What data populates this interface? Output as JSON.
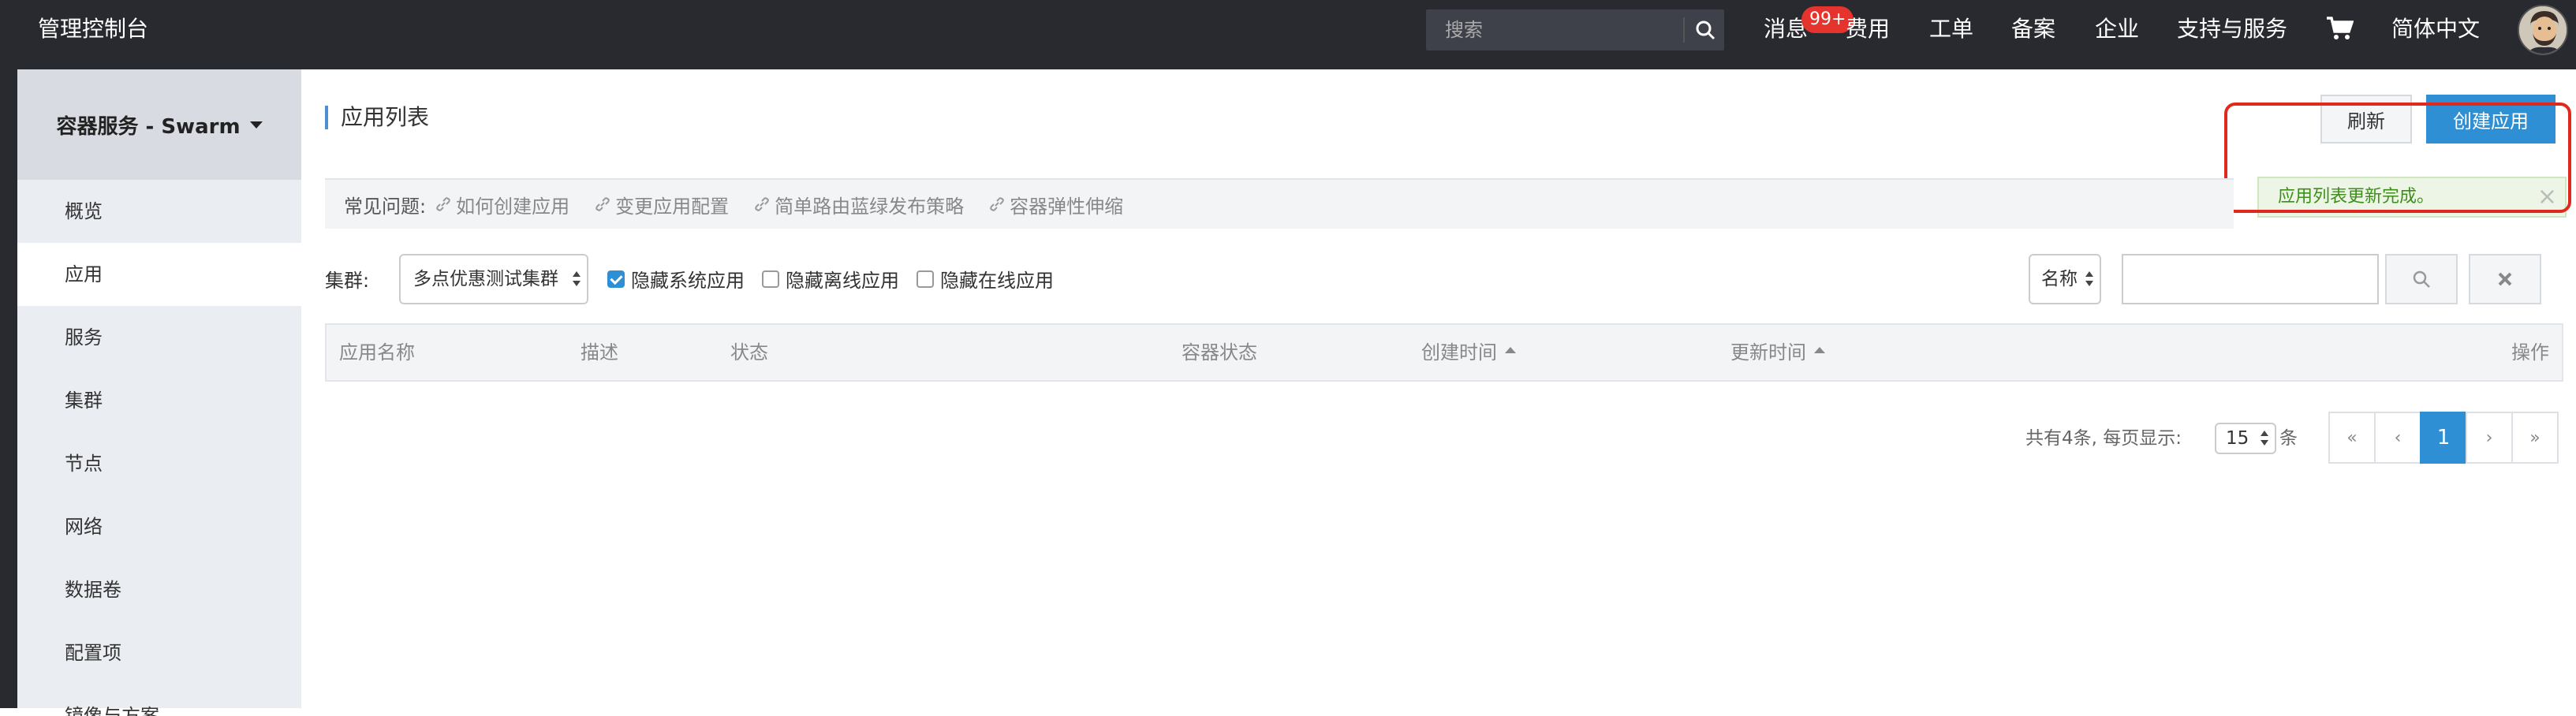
{
  "header": {
    "brand": "管理控制台",
    "search_placeholder": "搜索",
    "nav": {
      "messages": "消息",
      "messages_badge": "99+",
      "billing": "费用",
      "tickets": "工单",
      "filing": "备案",
      "enterprise": "企业",
      "support": "支持与服务",
      "language": "简体中文"
    },
    "cart_icon": "shopping-cart-icon",
    "avatar_icon": "user-avatar"
  },
  "sidebar": {
    "title": "容器服务 - Swarm",
    "items": [
      {
        "label": "概览",
        "active": false
      },
      {
        "label": "应用",
        "active": true
      },
      {
        "label": "服务",
        "active": false
      },
      {
        "label": "集群",
        "active": false
      },
      {
        "label": "节点",
        "active": false
      },
      {
        "label": "网络",
        "active": false
      },
      {
        "label": "数据卷",
        "active": false
      },
      {
        "label": "配置项",
        "active": false
      },
      {
        "label": "镜像与方案",
        "active": false
      }
    ]
  },
  "main": {
    "title": "应用列表",
    "refresh_label": "刷新",
    "create_label": "创建应用",
    "toast": "应用列表更新完成。",
    "faq": {
      "label": "常见问题:",
      "links": [
        "如何创建应用",
        "变更应用配置",
        "简单路由蓝绿发布策略",
        "容器弹性伸缩"
      ]
    },
    "filter": {
      "cluster_label": "集群:",
      "cluster_value": "多点优惠测试集群",
      "checkboxes": [
        {
          "label": "隐藏系统应用",
          "checked": true
        },
        {
          "label": "隐藏离线应用",
          "checked": false
        },
        {
          "label": "隐藏在线应用",
          "checked": false
        }
      ],
      "search_field": "名称",
      "search_value": ""
    },
    "table": {
      "columns": [
        "应用名称",
        "描述",
        "状态",
        "容器状态",
        "创建时间",
        "更新时间",
        "操作"
      ]
    },
    "pagination": {
      "total_text": "共有4条, 每页显示:",
      "page_size": "15",
      "unit": "条",
      "first": "«",
      "prev": "‹",
      "current": "1",
      "next": "›",
      "last": "»"
    }
  },
  "colors": {
    "topbar": "#282a30",
    "primary": "#2f8fd4",
    "badge": "#e5332d",
    "highlight": "#e0281e",
    "success_text": "#3e8e1a"
  }
}
